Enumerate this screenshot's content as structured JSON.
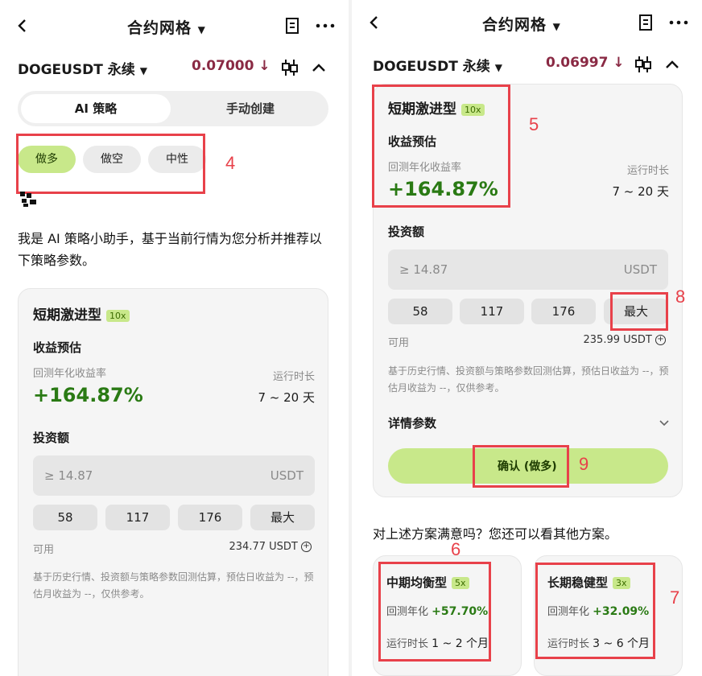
{
  "left": {
    "header": {
      "title": "合约网格"
    },
    "pair": {
      "name": "DOGEUSDT 永续",
      "price": "0.07000",
      "price_arrow": "↓"
    },
    "tabs": [
      {
        "label": "AI 策略"
      },
      {
        "label": "手动创建"
      }
    ],
    "directions": [
      {
        "label": "做多"
      },
      {
        "label": "做空"
      },
      {
        "label": "中性"
      }
    ],
    "annotation_4": "4",
    "assistant_text": "我是 AI 策略小助手，基于当前行情为您分析并推荐以下策略参数。",
    "card": {
      "title": "短期激进型",
      "leverage": "10x",
      "section": "收益预估",
      "roi_label": "回测年化收益率",
      "roi": "+164.87%",
      "duration_label": "运行时长",
      "duration": "7 ~ 20 天",
      "invest_label": "投资额",
      "input_placeholder": "≥ 14.87",
      "input_unit": "USDT",
      "amounts": [
        "58",
        "117",
        "176",
        "最大"
      ],
      "available_label": "可用",
      "available_value": "234.77 USDT",
      "note": "基于历史行情、投资额与策略参数回测估算，预估日收益为 --，预估月收益为 --，仅供参考。"
    }
  },
  "right": {
    "header": {
      "title": "合约网格"
    },
    "pair": {
      "name": "DOGEUSDT 永续",
      "price": "0.06997",
      "price_arrow": "↓"
    },
    "card": {
      "title": "短期激进型",
      "leverage": "10x",
      "section": "收益预估",
      "roi_label": "回测年化收益率",
      "roi": "+164.87%",
      "duration_label": "运行时长",
      "duration": "7 ~ 20 天",
      "invest_label": "投资额",
      "input_placeholder": "≥ 14.87",
      "input_unit": "USDT",
      "amounts": [
        "58",
        "117",
        "176",
        "最大"
      ],
      "available_label": "可用",
      "available_value": "235.99 USDT",
      "note": "基于历史行情、投资额与策略参数回测估算，预估日收益为 --，预估月收益为 --，仅供参考。",
      "details_label": "详情参数",
      "confirm_label": "确认 (做多)"
    },
    "annotations": {
      "n5": "5",
      "n6": "6",
      "n7": "7",
      "n8": "8",
      "n9": "9"
    },
    "other_prompt": "对上述方案满意吗？您还可以看其他方案。",
    "alt_cards": [
      {
        "title": "中期均衡型",
        "leverage": "5x",
        "roi_label": "回测年化",
        "roi": "+57.70%",
        "duration_label": "运行时长",
        "duration": "1 ~ 2 个月"
      },
      {
        "title": "长期稳健型",
        "leverage": "3x",
        "roi_label": "回测年化",
        "roi": "+32.09%",
        "duration_label": "运行时长",
        "duration": "3 ~ 6 个月"
      }
    ]
  },
  "colors": {
    "accent_green": "#c8e88a",
    "profit_green": "#2a7a14",
    "price_red": "#8a2a44",
    "annotation_red": "#e8414a"
  },
  "icons": [
    "back-arrow-icon",
    "dropdown-caret-icon",
    "document-icon",
    "more-icon",
    "candlestick-icon",
    "chevron-up-icon",
    "qr-icon",
    "plus-circle-icon",
    "chevron-down-icon"
  ]
}
